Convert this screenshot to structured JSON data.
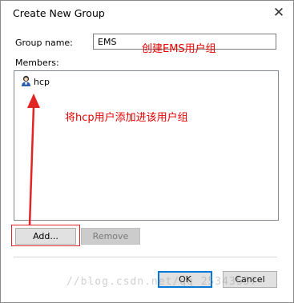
{
  "window": {
    "title": "Create New Group",
    "close_glyph": "✕"
  },
  "form": {
    "group_name_label": "Group name:",
    "group_name_value": "EMS",
    "members_label": "Members:"
  },
  "members": [
    {
      "name": "hcp",
      "icon": "user-icon"
    }
  ],
  "buttons": {
    "add": "Add...",
    "remove": "Remove",
    "ok": "OK",
    "cancel": "Cancel"
  },
  "annotations": {
    "create_group_note": "创建EMS用户组",
    "add_user_note": "将hcp用户添加进该用户组",
    "color": "#e60000"
  },
  "watermark": "//blog.csdn.net/qq_25343557"
}
